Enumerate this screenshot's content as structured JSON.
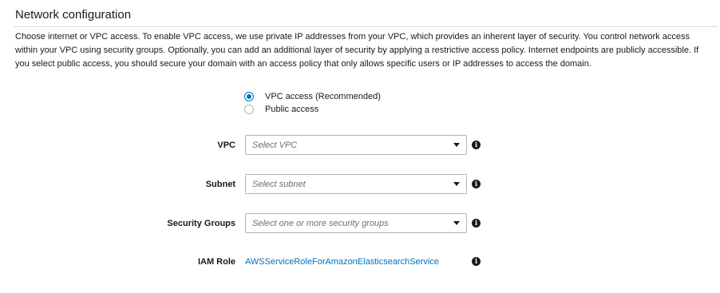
{
  "section": {
    "title": "Network configuration",
    "description": "Choose internet or VPC access. To enable VPC access, we use private IP addresses from your VPC, which provides an inherent layer of security. You control network access within your VPC using security groups. Optionally, you can add an additional layer of security by applying a restrictive access policy. Internet endpoints are publicly accessible. If you select public access, you should secure your domain with an access policy that only allows specific users or IP addresses to access the domain."
  },
  "access": {
    "options": [
      {
        "label": "VPC access (Recommended)",
        "selected": true
      },
      {
        "label": "Public access",
        "selected": false
      }
    ]
  },
  "fields": {
    "vpc": {
      "label": "VPC",
      "placeholder": "Select VPC"
    },
    "subnet": {
      "label": "Subnet",
      "placeholder": "Select subnet"
    },
    "security_groups": {
      "label": "Security Groups",
      "placeholder": "Select one or more security groups"
    },
    "iam_role": {
      "label": "IAM Role",
      "value": "AWSServiceRoleForAmazonElasticsearchService"
    }
  },
  "icons": {
    "info": "i",
    "dropdown": "caret-down-icon"
  },
  "colors": {
    "accent": "#0073bb",
    "text": "#16191f",
    "placeholder": "#687078",
    "border": "#aab7b8"
  }
}
